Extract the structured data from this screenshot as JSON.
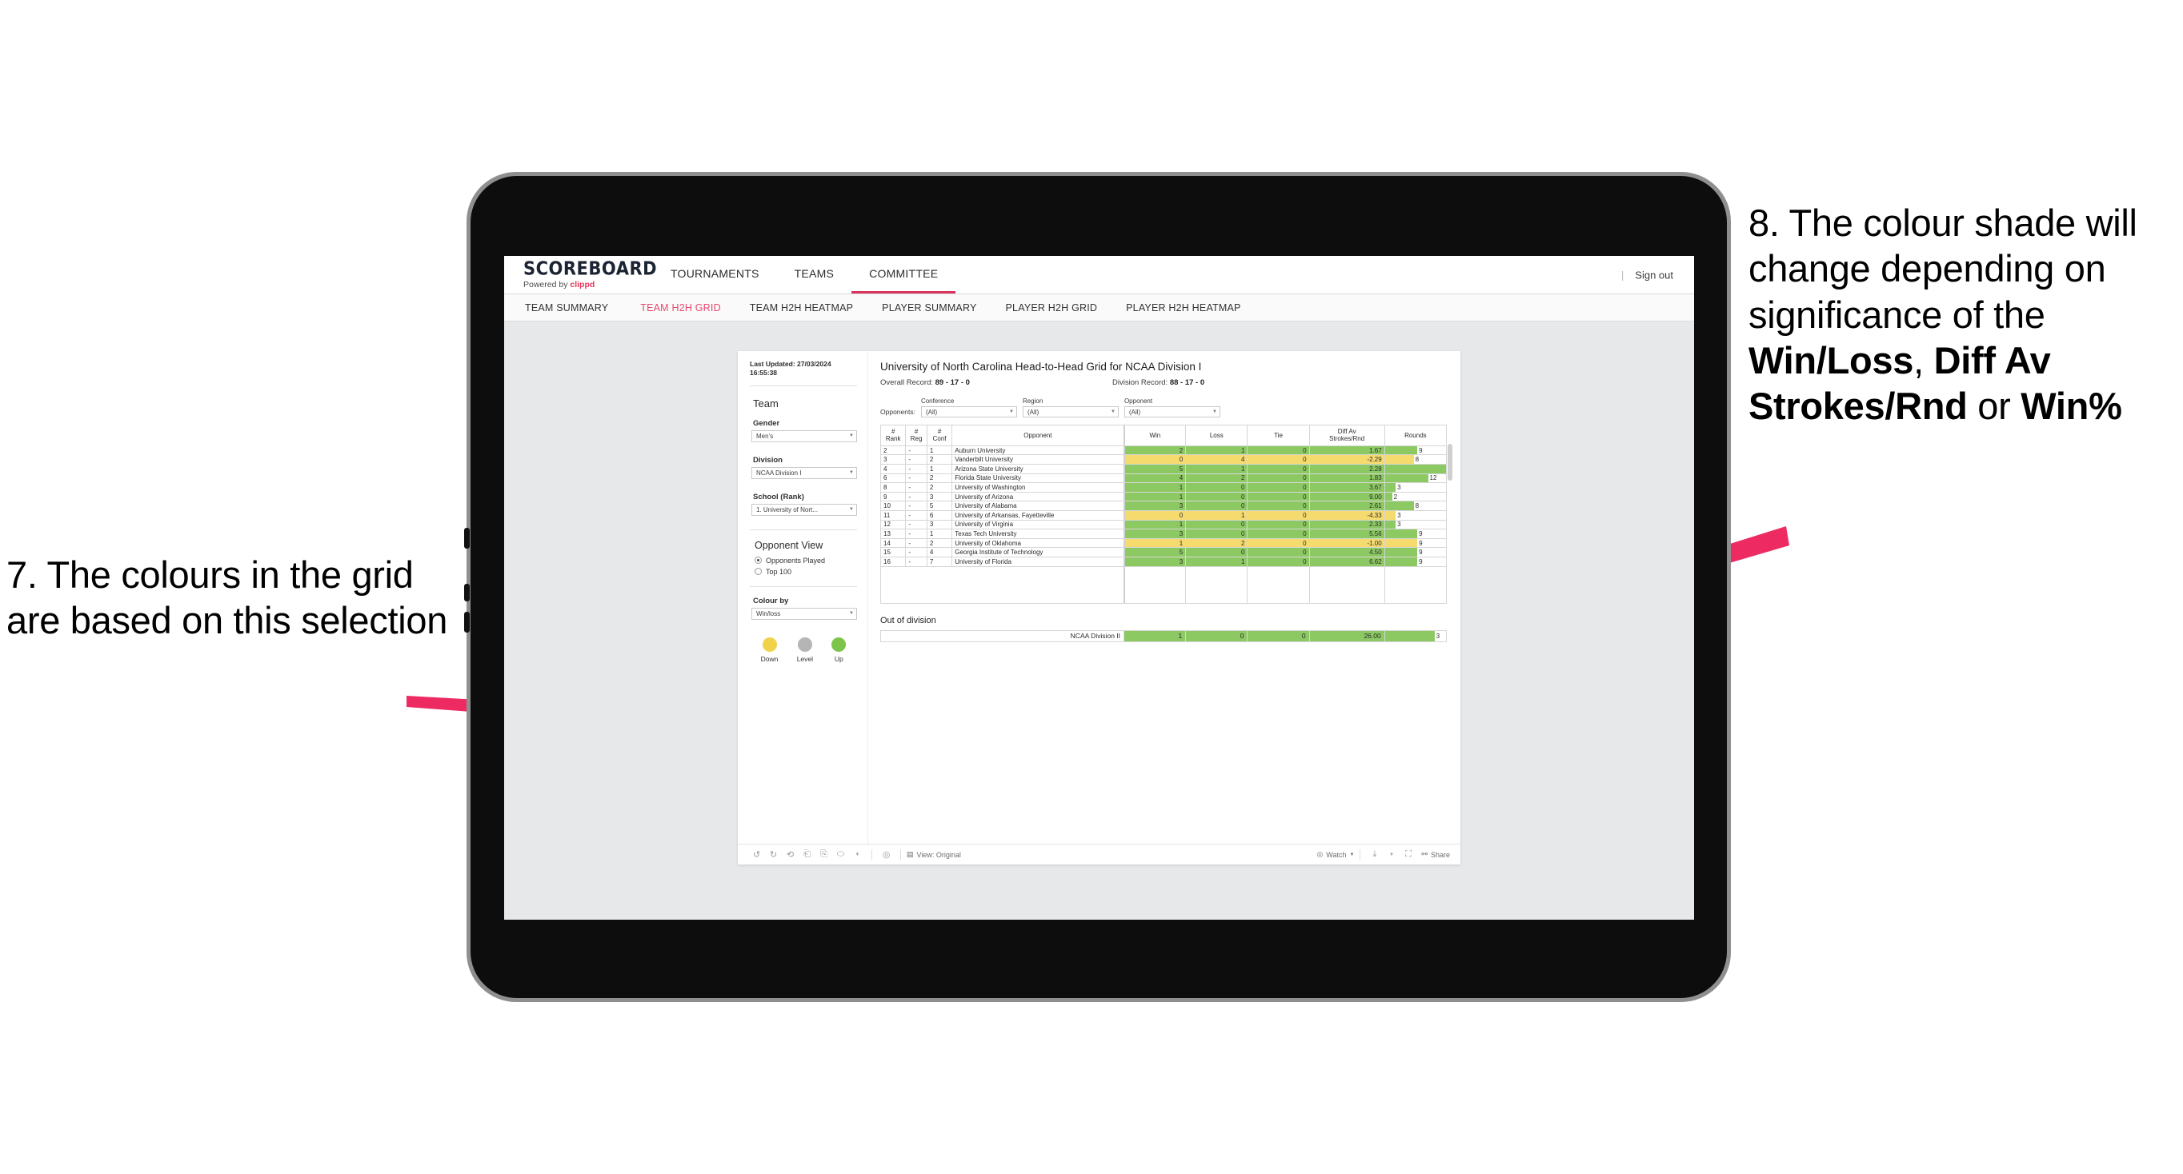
{
  "annotations": {
    "left": {
      "number": "7.",
      "text": "7. The colours in the grid are based on this selection"
    },
    "right": {
      "parts": [
        {
          "t": "8. The colour shade will change depending on significance of the ",
          "b": false
        },
        {
          "t": "Win/Loss",
          "b": true
        },
        {
          "t": ", ",
          "b": false
        },
        {
          "t": "Diff Av Strokes/Rnd",
          "b": true
        },
        {
          "t": " or ",
          "b": false
        },
        {
          "t": "Win%",
          "b": true
        }
      ]
    },
    "arrow_color": "#ED2B62"
  },
  "app": {
    "logo_main": "SCOREBOARD",
    "logo_sub_prefix": "Powered by ",
    "logo_brand": "clippd",
    "topnav": [
      {
        "label": "TOURNAMENTS",
        "active": false
      },
      {
        "label": "TEAMS",
        "active": false
      },
      {
        "label": "COMMITTEE",
        "active": true
      }
    ],
    "signout": "Sign out",
    "signout_divider": "|",
    "subnav": [
      {
        "label": "TEAM SUMMARY",
        "active": false
      },
      {
        "label": "TEAM H2H GRID",
        "active": true
      },
      {
        "label": "TEAM H2H HEATMAP",
        "active": false
      },
      {
        "label": "PLAYER SUMMARY",
        "active": false
      },
      {
        "label": "PLAYER H2H GRID",
        "active": false
      },
      {
        "label": "PLAYER H2H HEATMAP",
        "active": false
      }
    ]
  },
  "filters": {
    "last_updated": "Last Updated: 27/03/2024 16:55:38",
    "team_heading": "Team",
    "gender_label": "Gender",
    "gender_value": "Men's",
    "division_label": "Division",
    "division_value": "NCAA Division I",
    "school_label": "School (Rank)",
    "school_value": "1. University of Nort...",
    "opponent_view_heading": "Opponent View",
    "opponent_view_options": [
      {
        "label": "Opponents Played",
        "selected": true
      },
      {
        "label": "Top 100",
        "selected": false
      }
    ],
    "colour_by_label": "Colour by",
    "colour_by_value": "Win/loss",
    "legend": [
      {
        "label": "Down",
        "color": "#F0D24B"
      },
      {
        "label": "Level",
        "color": "#B5B5B5"
      },
      {
        "label": "Up",
        "color": "#7DC44A"
      }
    ]
  },
  "main": {
    "title": "University of North Carolina Head-to-Head Grid for NCAA Division I",
    "overall_record_label": "Overall Record: ",
    "overall_record_value": "89 - 17 - 0",
    "division_record_label": "Division Record: ",
    "division_record_value": "88 - 17 - 0",
    "opponents_label": "Opponents:",
    "opponent_filters": [
      {
        "label": "Conference",
        "value": "(All)"
      },
      {
        "label": "Region",
        "value": "(All)"
      },
      {
        "label": "Opponent",
        "value": "(All)"
      }
    ],
    "columns": [
      "# Rank",
      "# Reg",
      "# Conf",
      "Opponent",
      "Win",
      "Loss",
      "Tie",
      "Diff Av Strokes/Rnd",
      "Rounds"
    ],
    "out_of_division_title": "Out of division"
  },
  "chart_data": {
    "type": "table",
    "title": "University of North Carolina Head-to-Head Grid for NCAA Division I",
    "columns": [
      "# Rank",
      "# Reg",
      "# Conf",
      "Opponent",
      "Win",
      "Loss",
      "Tie",
      "Diff Av Strokes/Rnd",
      "Rounds"
    ],
    "colour_scale": {
      "up": "#8DC963",
      "down": "#F5DA6E",
      "level": "#B5B5B5"
    },
    "rounds_axis_max": 17,
    "rows": [
      {
        "rank": "2",
        "reg": "-",
        "conf": "1",
        "opponent": "Auburn University",
        "win": "2",
        "loss": "1",
        "tie": "0",
        "diff": "1.67",
        "rounds": 9,
        "state": "up"
      },
      {
        "rank": "3",
        "reg": "-",
        "conf": "2",
        "opponent": "Vanderbilt University",
        "win": "0",
        "loss": "4",
        "tie": "0",
        "diff": "-2.29",
        "rounds": 8,
        "state": "down"
      },
      {
        "rank": "4",
        "reg": "-",
        "conf": "1",
        "opponent": "Arizona State University",
        "win": "5",
        "loss": "1",
        "tie": "0",
        "diff": "2.28",
        "rounds": 17,
        "state": "up"
      },
      {
        "rank": "6",
        "reg": "-",
        "conf": "2",
        "opponent": "Florida State University",
        "win": "4",
        "loss": "2",
        "tie": "0",
        "diff": "1.83",
        "rounds": 12,
        "state": "up"
      },
      {
        "rank": "8",
        "reg": "-",
        "conf": "2",
        "opponent": "University of Washington",
        "win": "1",
        "loss": "0",
        "tie": "0",
        "diff": "3.67",
        "rounds": 3,
        "state": "up"
      },
      {
        "rank": "9",
        "reg": "-",
        "conf": "3",
        "opponent": "University of Arizona",
        "win": "1",
        "loss": "0",
        "tie": "0",
        "diff": "9.00",
        "rounds": 2,
        "state": "up"
      },
      {
        "rank": "10",
        "reg": "-",
        "conf": "5",
        "opponent": "University of Alabama",
        "win": "3",
        "loss": "0",
        "tie": "0",
        "diff": "2.61",
        "rounds": 8,
        "state": "up"
      },
      {
        "rank": "11",
        "reg": "-",
        "conf": "6",
        "opponent": "University of Arkansas, Fayetteville",
        "win": "0",
        "loss": "1",
        "tie": "0",
        "diff": "-4.33",
        "rounds": 3,
        "state": "down"
      },
      {
        "rank": "12",
        "reg": "-",
        "conf": "3",
        "opponent": "University of Virginia",
        "win": "1",
        "loss": "0",
        "tie": "0",
        "diff": "2.33",
        "rounds": 3,
        "state": "up"
      },
      {
        "rank": "13",
        "reg": "-",
        "conf": "1",
        "opponent": "Texas Tech University",
        "win": "3",
        "loss": "0",
        "tie": "0",
        "diff": "5.56",
        "rounds": 9,
        "state": "up"
      },
      {
        "rank": "14",
        "reg": "-",
        "conf": "2",
        "opponent": "University of Oklahoma",
        "win": "1",
        "loss": "2",
        "tie": "0",
        "diff": "-1.00",
        "rounds": 9,
        "state": "down"
      },
      {
        "rank": "15",
        "reg": "-",
        "conf": "4",
        "opponent": "Georgia Institute of Technology",
        "win": "5",
        "loss": "0",
        "tie": "0",
        "diff": "4.50",
        "rounds": 9,
        "state": "up"
      },
      {
        "rank": "16",
        "reg": "-",
        "conf": "7",
        "opponent": "University of Florida",
        "win": "3",
        "loss": "1",
        "tie": "0",
        "diff": "6.62",
        "rounds": 9,
        "state": "up"
      }
    ],
    "out_of_division": [
      {
        "opponent": "NCAA Division II",
        "win": "1",
        "loss": "0",
        "tie": "0",
        "diff": "26.00",
        "rounds": 3,
        "state": "up"
      }
    ]
  },
  "toolbar": {
    "view_label": "View: Original",
    "watch_label": "Watch",
    "share_label": "Share"
  }
}
